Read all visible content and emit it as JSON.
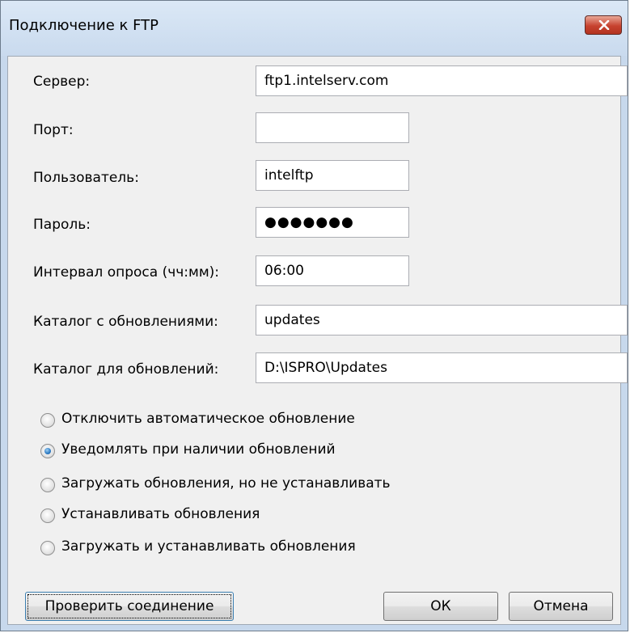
{
  "window": {
    "title": "Подключение к FTP"
  },
  "fields": [
    {
      "label": "Сервер:",
      "value": "ftp1.intelserv.com"
    },
    {
      "label": "Порт:",
      "value": ""
    },
    {
      "label": "Пользователь:",
      "value": "intelftp"
    },
    {
      "label": "Пароль:",
      "value": "●●●●●●●"
    },
    {
      "label": "Интервал опроса (чч:мм):",
      "value": "06:00"
    },
    {
      "label": "Каталог с обновлениями:",
      "value": "updates"
    },
    {
      "label": "Каталог для обновлений:",
      "value": "D:\\ISPRO\\Updates"
    }
  ],
  "options": [
    {
      "label": "Отключить автоматическое обновление",
      "selected": false
    },
    {
      "label": "Уведомлять при наличии обновлений",
      "selected": true
    },
    {
      "label": "Загружать обновления, но не устанавливать",
      "selected": false
    },
    {
      "label": "Устанавливать обновления",
      "selected": false
    },
    {
      "label": "Загружать и устанавливать обновления",
      "selected": false
    }
  ],
  "buttons": {
    "test": "Проверить соединение",
    "ok": "ОК",
    "cancel": "Отмена"
  },
  "colors": {
    "accent": "#2b79c2",
    "close": "#c7422f"
  }
}
